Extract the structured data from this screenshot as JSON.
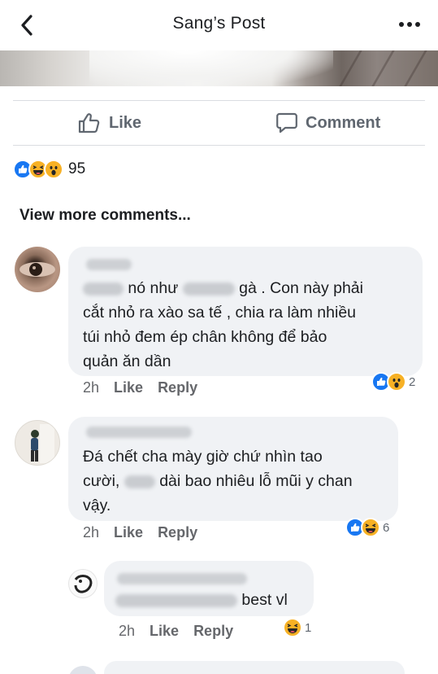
{
  "header": {
    "title": "Sang’s Post"
  },
  "actions": {
    "like_label": "Like",
    "comment_label": "Comment"
  },
  "reactions": {
    "count": "95",
    "icons": [
      "like-reaction",
      "haha-reaction",
      "wow-reaction"
    ]
  },
  "view_more": "View more comments...",
  "comments": [
    {
      "text_lines": [
        "gà . Con này phải",
        "cắt nhỏ ra xào sa tế , chia ra làm nhiều",
        "túi nhỏ đem ép chân không để bảo",
        "quản ăn dần"
      ],
      "text_fragments": [
        "nó như"
      ],
      "time": "2h",
      "like": "Like",
      "reply": "Reply",
      "reaction_count": "2"
    },
    {
      "text_lines": [
        "Đá chết cha mày giờ chứ nhìn tao",
        "dài bao nhiêu lỗ mũi y chan",
        "vậy."
      ],
      "text_fragments": [
        "cười,"
      ],
      "time": "2h",
      "like": "Like",
      "reply": "Reply",
      "reaction_count": "6"
    },
    {
      "text": "best vl",
      "time": "2h",
      "like": "Like",
      "reply": "Reply",
      "reaction_count": "1"
    }
  ],
  "colors": {
    "like_blue": "#1877f2",
    "emoji_yellow": "#f7b125",
    "bubble_gray": "#f0f2f5",
    "meta_gray": "#65676b"
  }
}
